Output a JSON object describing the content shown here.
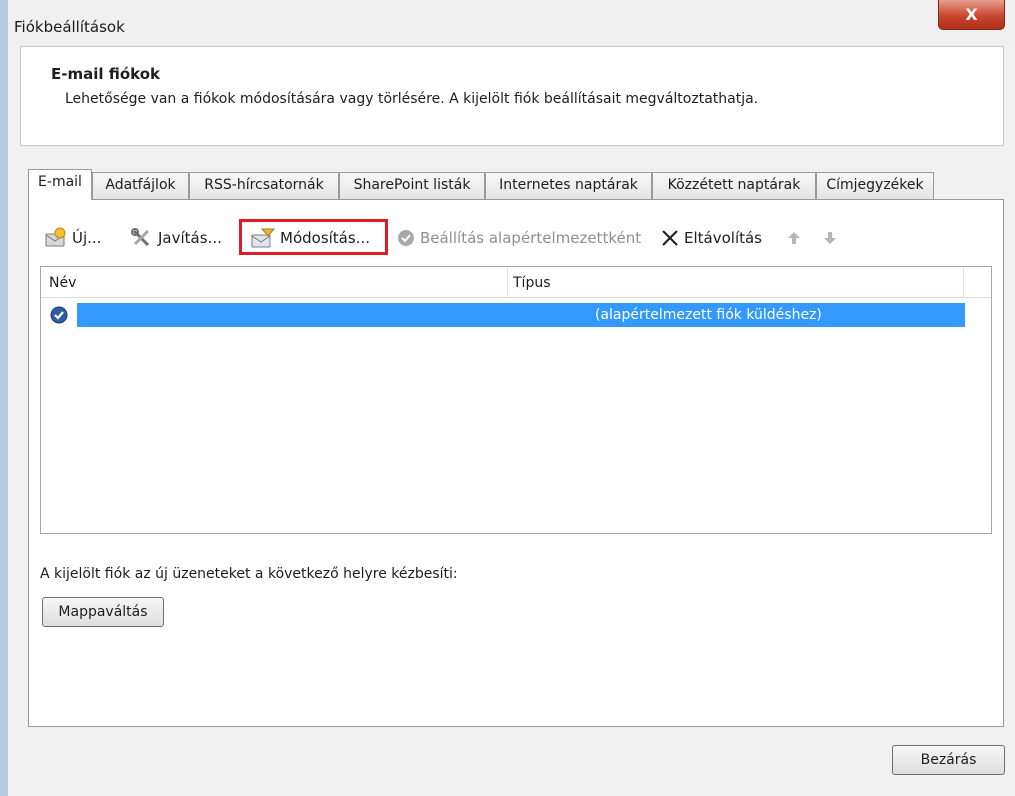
{
  "window": {
    "title": "Fiókbeállítások",
    "close_glyph": "X"
  },
  "header": {
    "title": "E-mail fiókok",
    "description": "Lehetősége van a fiókok módosítására vagy törlésére. A kijelölt fiók beállításait megváltoztathatja."
  },
  "tabs": [
    {
      "label": "E-mail",
      "active": true
    },
    {
      "label": "Adatfájlok"
    },
    {
      "label": "RSS-hírcsatornák"
    },
    {
      "label": "SharePoint listák"
    },
    {
      "label": "Internetes naptárak"
    },
    {
      "label": "Közzétett naptárak"
    },
    {
      "label": "Címjegyzékek"
    }
  ],
  "toolbar": {
    "new_label": "Új...",
    "repair_label": "Javítás...",
    "change_label": "Módosítás...",
    "set_default_label": "Beállítás alapértelmezettként",
    "remove_label": "Eltávolítás",
    "icons": [
      "new-account-icon",
      "repair-tools-icon",
      "change-account-icon",
      "check-circle-icon",
      "remove-x-icon",
      "arrow-up-icon",
      "arrow-down-icon"
    ]
  },
  "list": {
    "columns": [
      "Név",
      "Típus"
    ],
    "rows": [
      {
        "name": "",
        "type": "(alapértelmezett fiók küldéshez)",
        "selected": true
      }
    ]
  },
  "delivery": {
    "text": "A kijelölt fiók az új üzeneteket a következő helyre kézbesíti:",
    "change_folder_label": "Mappaváltás"
  },
  "footer": {
    "close_label": "Bezárás"
  },
  "colors": {
    "selection": "#3399ff",
    "highlight_box": "#e01b24",
    "close_button": "#c9472f"
  }
}
